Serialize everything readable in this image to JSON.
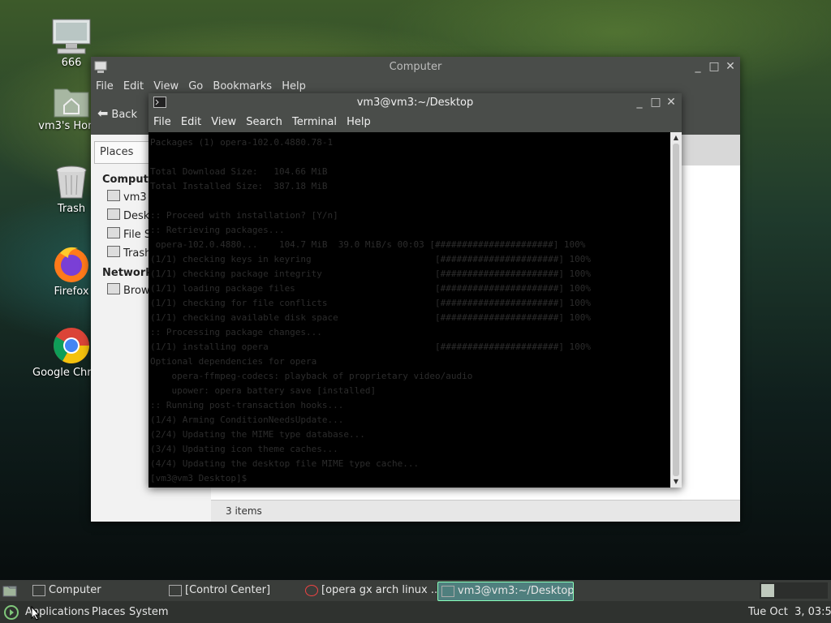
{
  "desktop": {
    "icons": [
      {
        "label": "666",
        "icon": "computer-monitor-icon"
      },
      {
        "label": "vm3's Home",
        "icon": "home-folder-icon"
      },
      {
        "label": "Trash",
        "icon": "trash-icon"
      },
      {
        "label": "Firefox",
        "icon": "firefox-icon"
      },
      {
        "label": "Google Chrome",
        "icon": "chrome-icon"
      }
    ]
  },
  "caja": {
    "title": "Computer",
    "menu": [
      "File",
      "Edit",
      "View",
      "Go",
      "Bookmarks",
      "Help"
    ],
    "back_label": "Back",
    "places_label": "Places",
    "sidebar": {
      "computer_header": "Computer",
      "computer_items": [
        "vm3",
        "Desktop",
        "File System",
        "Trash"
      ],
      "network_header": "Network",
      "network_items": [
        "Browse Network"
      ]
    },
    "status": "3 items"
  },
  "terminal": {
    "title": "vm3@vm3:~/Desktop",
    "menu": [
      "File",
      "Edit",
      "View",
      "Search",
      "Terminal",
      "Help"
    ],
    "lines": [
      "Packages (1) opera-102.0.4880.78-1",
      "",
      "Total Download Size:   104.66 MiB",
      "Total Installed Size:  387.18 MiB",
      "",
      ":: Proceed with installation? [Y/n]",
      ":: Retrieving packages...",
      " opera-102.0.4880...    104.7 MiB  39.0 MiB/s 00:03 [######################] 100%",
      "(1/1) checking keys in keyring                       [######################] 100%",
      "(1/1) checking package integrity                     [######################] 100%",
      "(1/1) loading package files                          [######################] 100%",
      "(1/1) checking for file conflicts                    [######################] 100%",
      "(1/1) checking available disk space                  [######################] 100%",
      ":: Processing package changes...",
      "(1/1) installing opera                               [######################] 100%",
      "Optional dependencies for opera",
      "    opera-ffmpeg-codecs: playback of proprietary video/audio",
      "    upower: opera battery save [installed]",
      ":: Running post-transaction hooks...",
      "(1/4) Arming ConditionNeedsUpdate...",
      "(2/4) Updating the MIME type database...",
      "(3/4) Updating icon theme caches...",
      "(4/4) Updating the desktop file MIME type cache...",
      "[vm3@vm3 Desktop]$"
    ]
  },
  "taskbar": {
    "tasks": [
      {
        "label": "Computer",
        "icon": "folder-window-icon"
      },
      {
        "label": "[Control Center]",
        "icon": "control-center-icon"
      },
      {
        "label": "[opera gx arch linux ...",
        "icon": "chrome-icon"
      },
      {
        "label": "vm3@vm3:~/Desktop",
        "icon": "terminal-icon"
      }
    ]
  },
  "mainpanel": {
    "applications": "Applications",
    "places": "Places",
    "system": "System",
    "clock": "Tue Oct  3, 03:52"
  },
  "colors": {
    "accent": "#4f7f7e",
    "panel": "#3a3d3a"
  }
}
